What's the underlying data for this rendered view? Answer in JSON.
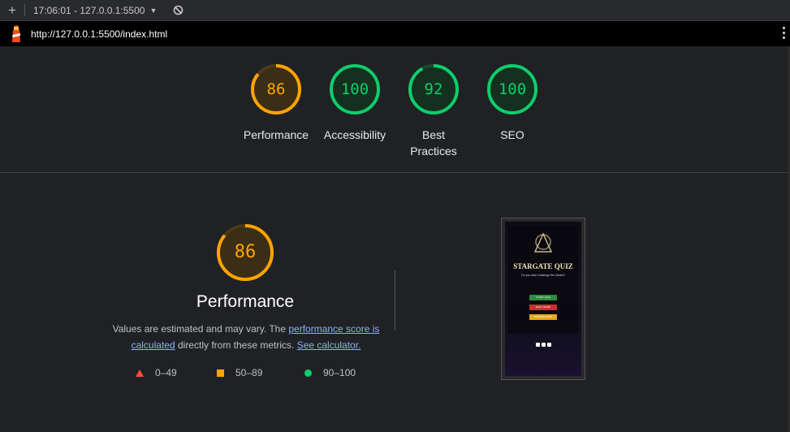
{
  "topbar": {
    "add_label": "+",
    "session": "17:06:01 - 127.0.0.1:5500",
    "caret": "▼"
  },
  "url": "http://127.0.0.1:5500/index.html",
  "gauges": [
    {
      "score": "86",
      "label": "Performance",
      "color": "#ffa400"
    },
    {
      "score": "100",
      "label": "Accessibility",
      "color": "#0cce6b"
    },
    {
      "score": "92",
      "label": "Best Practices",
      "color": "#0cce6b"
    },
    {
      "score": "100",
      "label": "SEO",
      "color": "#0cce6b"
    }
  ],
  "performance": {
    "score": "86",
    "title": "Performance",
    "desc_prefix": "Values are estimated and may vary. The ",
    "desc_link": "performance score is calculated",
    "desc_middle": " directly from these metrics. ",
    "desc_link2": "See calculator.",
    "legend": [
      {
        "range": "0–49",
        "color": "#ff4e42"
      },
      {
        "range": "50–89",
        "color": "#ffa400"
      },
      {
        "range": "90–100",
        "color": "#0cce6b"
      }
    ]
  },
  "screenshot": {
    "title": "STARGATE QUIZ",
    "subtitle": "Do you dare challenge the Daniel?",
    "buttons": [
      {
        "label": "START QUIZ",
        "color": "#2e8b3e"
      },
      {
        "label": "EASY MODE",
        "color": "#c8312e"
      },
      {
        "label": "INSTRUCTIONS",
        "color": "#e5a91c"
      }
    ]
  }
}
